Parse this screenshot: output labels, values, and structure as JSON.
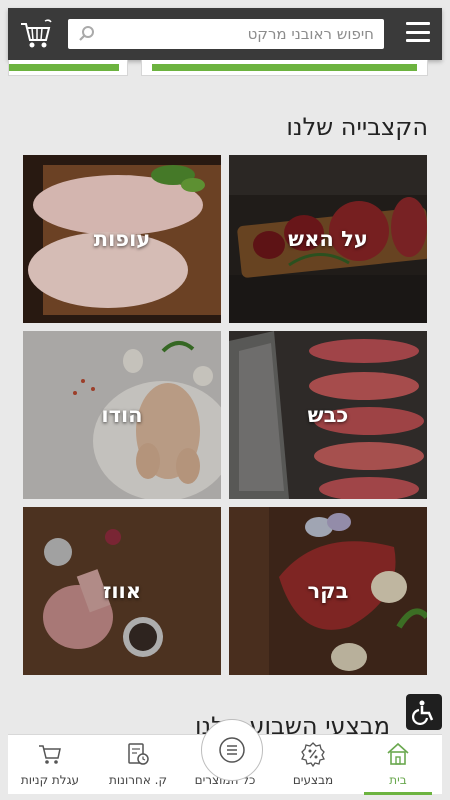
{
  "header": {
    "search_placeholder": "חיפוש ראובני מרקט"
  },
  "section": {
    "title": "הקצבייה שלנו",
    "next_title": "מבצעי השבוע שלנו"
  },
  "categories": [
    {
      "label": "על האש"
    },
    {
      "label": "עופות"
    },
    {
      "label": "כבש"
    },
    {
      "label": "הודו"
    },
    {
      "label": "בקר"
    },
    {
      "label": "אווז"
    }
  ],
  "bottom_nav": {
    "items": [
      {
        "label": "בית",
        "icon": "home-icon",
        "active": true
      },
      {
        "label": "מבצעים",
        "icon": "percent-badge-icon",
        "active": false
      },
      {
        "label": "כל המוצרים",
        "icon": "list-icon",
        "active": false
      },
      {
        "label": "ק. אחרונות",
        "icon": "recent-orders-icon",
        "active": false
      },
      {
        "label": "עגלת קניות",
        "icon": "cart-icon",
        "active": false
      }
    ]
  },
  "colors": {
    "header_bg": "#3a3a3a",
    "accent_green": "#6cb33f",
    "page_bg": "#e9e9e9"
  }
}
